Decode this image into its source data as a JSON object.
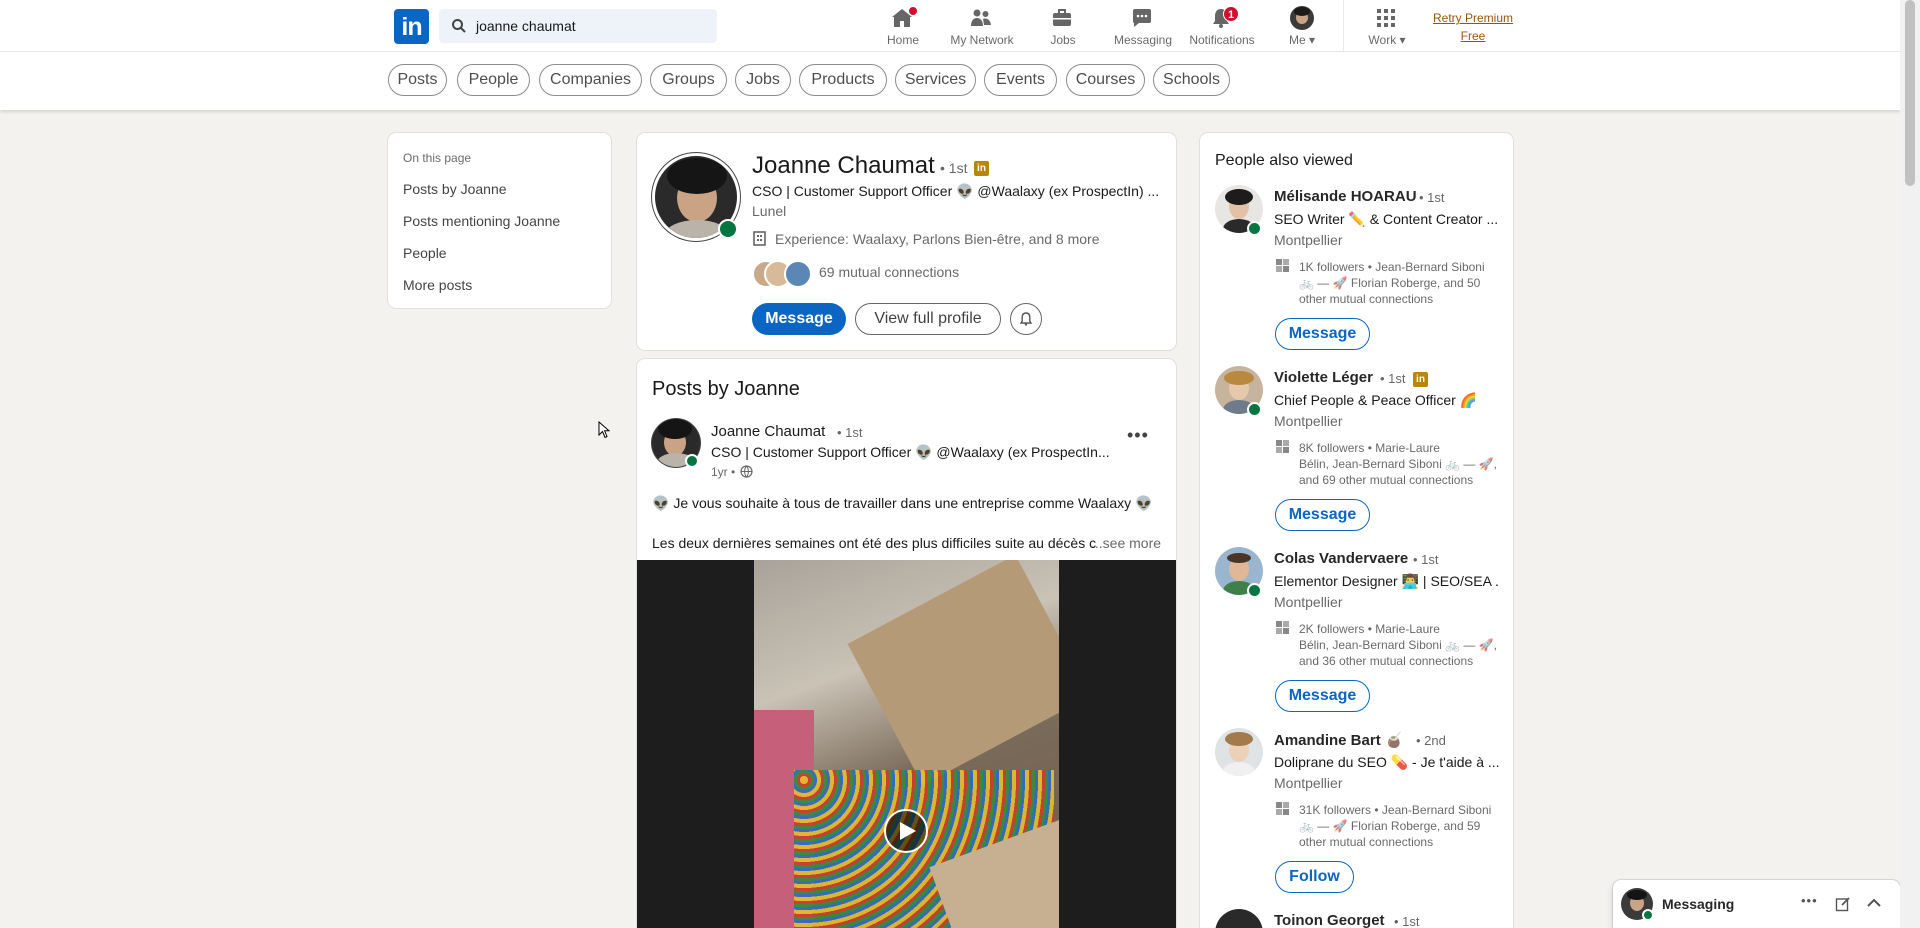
{
  "nav": {
    "search_value": "joanne chaumat",
    "items": [
      {
        "label": "Home",
        "icon": "home-icon",
        "badge": "1"
      },
      {
        "label": "My Network",
        "icon": "network-icon"
      },
      {
        "label": "Jobs",
        "icon": "briefcase-icon"
      },
      {
        "label": "Messaging",
        "icon": "messaging-icon"
      },
      {
        "label": "Notifications",
        "icon": "bell-icon",
        "badge": "1"
      },
      {
        "label": "Me ▾",
        "icon": "avatar"
      },
      {
        "label": "Work ▾",
        "icon": "grid-icon"
      }
    ],
    "premium_line1": "Retry Premium",
    "premium_line2": "Free"
  },
  "filters": [
    "Posts",
    "People",
    "Companies",
    "Groups",
    "Jobs",
    "Products",
    "Services",
    "Events",
    "Courses",
    "Schools"
  ],
  "toc": {
    "heading": "On this page",
    "items": [
      "Posts by Joanne",
      "Posts mentioning Joanne",
      "People",
      "More posts"
    ]
  },
  "profile": {
    "name": "Joanne Chaumat",
    "degree": "• 1st",
    "headline": "CSO | Customer Support Officer 👽 @Waalaxy (ex ProspectIn) ...",
    "location": "Lunel",
    "experience": "Experience: Waalaxy, Parlons Bien-être, and 8 more",
    "mutual": "69 mutual connections",
    "message_btn": "Message",
    "view_profile_btn": "View full profile"
  },
  "posts": {
    "title": "Posts by Joanne",
    "author": "Joanne Chaumat",
    "author_degree": "• 1st",
    "author_headline": "CSO | Customer Support Officer 👽 @Waalaxy (ex ProspectIn...",
    "time": "1yr •",
    "line1": "👽 Je vous souhaite à tous de travailler dans une entreprise comme Waalaxy 👽",
    "line2": "Les deux dernières semaines ont été des plus difficiles suite au décès c",
    "see_more": "...see more"
  },
  "people_also_viewed": {
    "title": "People also viewed",
    "people": [
      {
        "name": "Mélisande HOARAU",
        "degree": "• 1st",
        "headline": "SEO Writer ✏️ & Content Creator ...",
        "location": "Montpellier",
        "followers1": "1K followers • Jean-Bernard Siboni",
        "followers2": "🚲 — 🚀 Florian Roberge, and 50",
        "followers3": "other mutual connections",
        "button": "Message",
        "online": true
      },
      {
        "name": "Violette Léger",
        "degree": "• 1st",
        "headline": "Chief People & Peace Officer 🌈",
        "location": "Montpellier",
        "followers1": "8K followers • Marie-Laure",
        "followers2": "Bélin, Jean-Bernard Siboni 🚲 — 🚀,",
        "followers3": "and 69 other mutual connections",
        "button": "Message",
        "online": true
      },
      {
        "name": "Colas Vandervaere",
        "degree": "• 1st",
        "headline": "Elementor Designer 👨‍💻 | SEO/SEA ...",
        "location": "Montpellier",
        "followers1": "2K followers • Marie-Laure",
        "followers2": "Bélin, Jean-Bernard Siboni 🚲 — 🚀,",
        "followers3": "and 36 other mutual connections",
        "button": "Message",
        "online": true
      },
      {
        "name": "Amandine Bart 🧉",
        "degree": "• 2nd",
        "headline": "Doliprane du SEO 💊 - Je t'aide à ...",
        "location": "Montpellier",
        "followers1": "31K followers • Jean-Bernard Siboni",
        "followers2": "🚲 — 🚀 Florian Roberge, and 59",
        "followers3": "other mutual connections",
        "button": "Follow",
        "online": false
      }
    ],
    "next_name": "Toinon Georget",
    "next_degree": "• 1st"
  },
  "messaging": {
    "label": "Messaging"
  },
  "colors": {
    "brand": "#0a66c2",
    "online": "#057642",
    "badge": "#cb112d",
    "premium": "#915907"
  }
}
